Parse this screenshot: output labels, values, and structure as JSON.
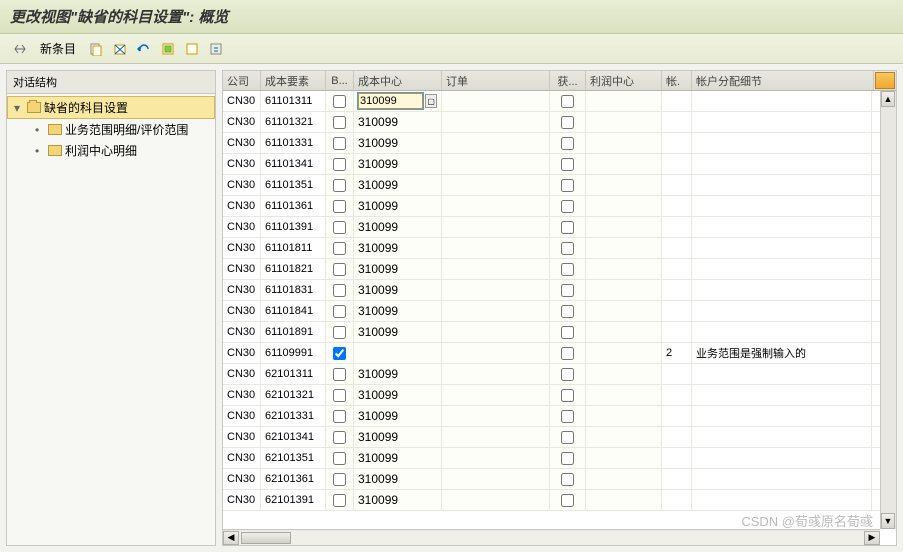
{
  "title": "更改视图\"缺省的科目设置\": 概览",
  "toolbar": {
    "new_entry": "新条目"
  },
  "tree": {
    "header": "对话结构",
    "root": "缺省的科目设置",
    "children": [
      "业务范围明细/评价范围",
      "利润中心明细"
    ]
  },
  "table": {
    "headers": {
      "company": "公司",
      "cost_element": "成本要素",
      "b": "B...",
      "cost_center": "成本中心",
      "order": "订单",
      "get": "获...",
      "profit_center": "利润中心",
      "acct": "帐.",
      "detail": "帐户分配细节"
    },
    "rows": [
      {
        "company": "CN30",
        "element": "61101311",
        "b": false,
        "center": "310099",
        "order": "",
        "get": false,
        "profit": "",
        "acct": "",
        "detail": "",
        "active": true
      },
      {
        "company": "CN30",
        "element": "61101321",
        "b": false,
        "center": "310099",
        "order": "",
        "get": false,
        "profit": "",
        "acct": "",
        "detail": ""
      },
      {
        "company": "CN30",
        "element": "61101331",
        "b": false,
        "center": "310099",
        "order": "",
        "get": false,
        "profit": "",
        "acct": "",
        "detail": ""
      },
      {
        "company": "CN30",
        "element": "61101341",
        "b": false,
        "center": "310099",
        "order": "",
        "get": false,
        "profit": "",
        "acct": "",
        "detail": ""
      },
      {
        "company": "CN30",
        "element": "61101351",
        "b": false,
        "center": "310099",
        "order": "",
        "get": false,
        "profit": "",
        "acct": "",
        "detail": ""
      },
      {
        "company": "CN30",
        "element": "61101361",
        "b": false,
        "center": "310099",
        "order": "",
        "get": false,
        "profit": "",
        "acct": "",
        "detail": ""
      },
      {
        "company": "CN30",
        "element": "61101391",
        "b": false,
        "center": "310099",
        "order": "",
        "get": false,
        "profit": "",
        "acct": "",
        "detail": ""
      },
      {
        "company": "CN30",
        "element": "61101811",
        "b": false,
        "center": "310099",
        "order": "",
        "get": false,
        "profit": "",
        "acct": "",
        "detail": ""
      },
      {
        "company": "CN30",
        "element": "61101821",
        "b": false,
        "center": "310099",
        "order": "",
        "get": false,
        "profit": "",
        "acct": "",
        "detail": ""
      },
      {
        "company": "CN30",
        "element": "61101831",
        "b": false,
        "center": "310099",
        "order": "",
        "get": false,
        "profit": "",
        "acct": "",
        "detail": ""
      },
      {
        "company": "CN30",
        "element": "61101841",
        "b": false,
        "center": "310099",
        "order": "",
        "get": false,
        "profit": "",
        "acct": "",
        "detail": ""
      },
      {
        "company": "CN30",
        "element": "61101891",
        "b": false,
        "center": "310099",
        "order": "",
        "get": false,
        "profit": "",
        "acct": "",
        "detail": ""
      },
      {
        "company": "CN30",
        "element": "61109991",
        "b": true,
        "center": "",
        "order": "",
        "get": false,
        "profit": "",
        "acct": "2",
        "detail": "业务范围是强制输入的"
      },
      {
        "company": "CN30",
        "element": "62101311",
        "b": false,
        "center": "310099",
        "order": "",
        "get": false,
        "profit": "",
        "acct": "",
        "detail": ""
      },
      {
        "company": "CN30",
        "element": "62101321",
        "b": false,
        "center": "310099",
        "order": "",
        "get": false,
        "profit": "",
        "acct": "",
        "detail": ""
      },
      {
        "company": "CN30",
        "element": "62101331",
        "b": false,
        "center": "310099",
        "order": "",
        "get": false,
        "profit": "",
        "acct": "",
        "detail": ""
      },
      {
        "company": "CN30",
        "element": "62101341",
        "b": false,
        "center": "310099",
        "order": "",
        "get": false,
        "profit": "",
        "acct": "",
        "detail": ""
      },
      {
        "company": "CN30",
        "element": "62101351",
        "b": false,
        "center": "310099",
        "order": "",
        "get": false,
        "profit": "",
        "acct": "",
        "detail": ""
      },
      {
        "company": "CN30",
        "element": "62101361",
        "b": false,
        "center": "310099",
        "order": "",
        "get": false,
        "profit": "",
        "acct": "",
        "detail": ""
      },
      {
        "company": "CN30",
        "element": "62101391",
        "b": false,
        "center": "310099",
        "order": "",
        "get": false,
        "profit": "",
        "acct": "",
        "detail": ""
      }
    ]
  },
  "watermark": "CSDN @荀彧原名荀彧"
}
